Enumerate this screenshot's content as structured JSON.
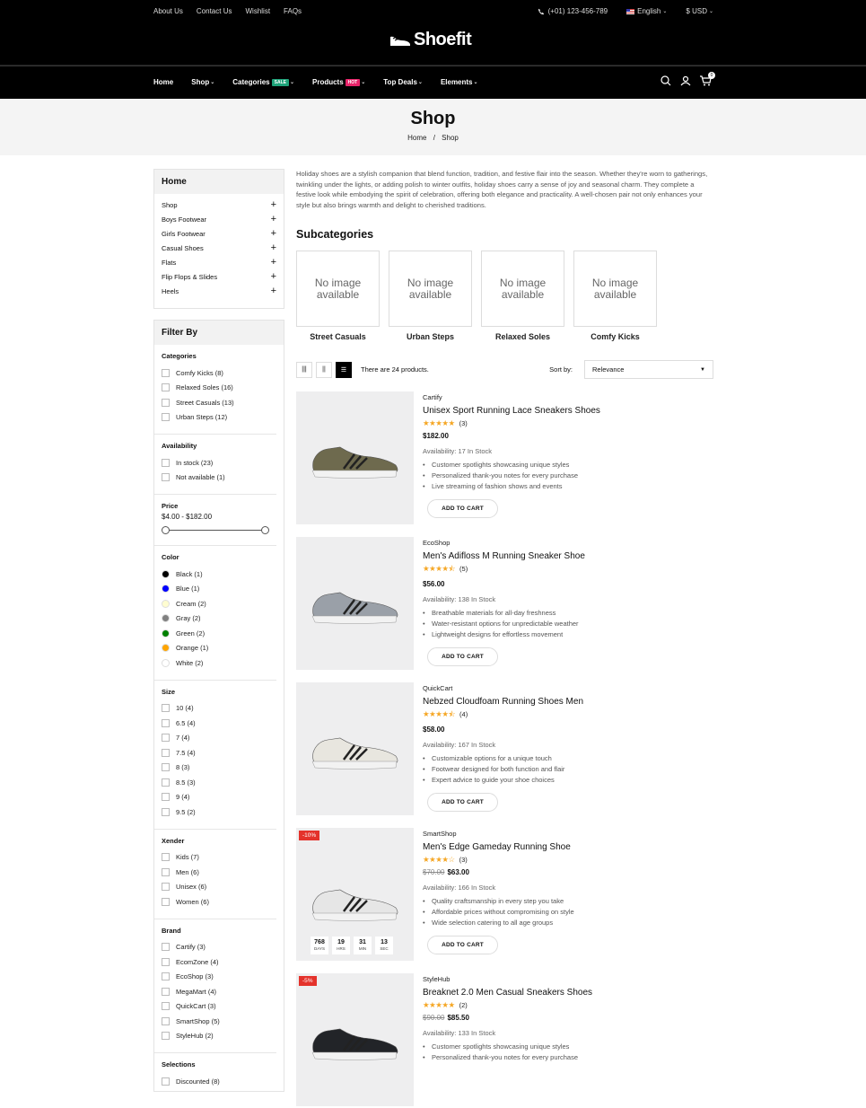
{
  "topbar": {
    "links": [
      "About Us",
      "Contact Us",
      "Wishlist",
      "FAQs"
    ],
    "phone": "(+01) 123-456-789",
    "language": "English",
    "currency": "$ USD"
  },
  "logo": {
    "text": "Shoefit"
  },
  "nav": {
    "items": [
      {
        "label": "Home"
      },
      {
        "label": "Shop"
      },
      {
        "label": "Categories",
        "badge": "SALE",
        "badge_color": "#1fa37a"
      },
      {
        "label": "Products",
        "badge": "HOT",
        "badge_color": "#e8246a"
      },
      {
        "label": "Top Deals"
      },
      {
        "label": "Elements"
      }
    ],
    "cart_count": "0"
  },
  "hero": {
    "title": "Shop",
    "crumb_home": "Home",
    "crumb_sep": "/",
    "crumb_current": "Shop"
  },
  "sidebar": {
    "cat_title": "Home",
    "categories": [
      "Shop",
      "Boys Footwear",
      "Girls Footwear",
      "Casual Shoes",
      "Flats",
      "Flip Flops & Slides",
      "Heels"
    ],
    "filter_title": "Filter By",
    "groups": [
      {
        "title": "Categories",
        "items": [
          "Comfy Kicks (8)",
          "Relaxed Soles (16)",
          "Street Casuals (13)",
          "Urban Steps (12)"
        ]
      },
      {
        "title": "Availability",
        "items": [
          "In stock (23)",
          "Not available (1)"
        ]
      },
      {
        "title": "Size",
        "items": [
          "10 (4)",
          "6.5 (4)",
          "7 (4)",
          "7.5 (4)",
          "8 (3)",
          "8.5 (3)",
          "9 (4)",
          "9.5 (2)"
        ]
      },
      {
        "title": "Xender",
        "items": [
          "Kids (7)",
          "Men (6)",
          "Unisex (6)",
          "Women (6)"
        ]
      },
      {
        "title": "Brand",
        "items": [
          "Cartify (3)",
          "EcomZone (4)",
          "EcoShop (3)",
          "MegaMart (4)",
          "QuickCart (3)",
          "SmartShop (5)",
          "StyleHub (2)"
        ]
      },
      {
        "title": "Selections",
        "items": [
          "Discounted (8)"
        ]
      }
    ],
    "price": {
      "title": "Price",
      "range": "$4.00 - $182.00"
    },
    "color": {
      "title": "Color",
      "items": [
        {
          "label": "Black (1)",
          "hex": "#000000"
        },
        {
          "label": "Blue (1)",
          "hex": "#0000ff"
        },
        {
          "label": "Cream (2)",
          "hex": "#fffdd0"
        },
        {
          "label": "Gray (2)",
          "hex": "#808080"
        },
        {
          "label": "Green (2)",
          "hex": "#008000"
        },
        {
          "label": "Orange (1)",
          "hex": "#ffa500"
        },
        {
          "label": "White (2)",
          "hex": "#ffffff"
        }
      ]
    }
  },
  "main": {
    "description": "Holiday shoes are a stylish companion that blend function, tradition, and festive flair into the season. Whether they're worn to gatherings, twinkling under the lights, or adding polish to winter outfits, holiday shoes carry a sense of joy and seasonal charm. They complete a festive look while embodying the spirit of celebration, offering both elegance and practicality. A well-chosen pair not only enhances your style but also brings warmth and delight to cherished traditions.",
    "subcat_title": "Subcategories",
    "subcats": [
      {
        "name": "Street Casuals",
        "img": "No image available"
      },
      {
        "name": "Urban Steps",
        "img": "No image available"
      },
      {
        "name": "Relaxed Soles",
        "img": "No image available"
      },
      {
        "name": "Comfy Kicks",
        "img": "No image available"
      }
    ],
    "count_text": "There are 24 products.",
    "sort_label": "Sort by:",
    "sort_value": "Relevance",
    "add_to_cart": "ADD TO CART",
    "products": [
      {
        "brand": "Cartify",
        "name": "Unisex Sport Running Lace Sneakers Shoes",
        "stars": "★★★★★",
        "rating_count": "(3)",
        "old_price": "",
        "price": "$182.00",
        "availability": "Availability: 17 In Stock",
        "features": [
          "Customer spotlights showcasing unique styles",
          "Personalized thank-you notes for every purchase",
          "Live streaming of fashion shows and events"
        ],
        "discount": "",
        "shoe": "#6e6a4e"
      },
      {
        "brand": "EcoShop",
        "name": "Men's Adifloss M Running Sneaker Shoe",
        "stars": "★★★★⯪",
        "rating_count": "(5)",
        "old_price": "",
        "price": "$56.00",
        "availability": "Availability: 138 In Stock",
        "features": [
          "Breathable materials for all-day freshness",
          "Water-resistant options for unpredictable weather",
          "Lightweight designs for effortless movement"
        ],
        "discount": "",
        "shoe": "#9aa0a8"
      },
      {
        "brand": "QuickCart",
        "name": "Nebzed Cloudfoam Running Shoes Men",
        "stars": "★★★★⯪",
        "rating_count": "(4)",
        "old_price": "",
        "price": "$58.00",
        "availability": "Availability: 167 In Stock",
        "features": [
          "Customizable options for a unique touch",
          "Footwear designed for both function and flair",
          "Expert advice to guide your shoe choices"
        ],
        "discount": "",
        "shoe": "#e8e6df"
      },
      {
        "brand": "SmartShop",
        "name": "Men's Edge Gameday Running Shoe",
        "stars": "★★★★☆",
        "rating_count": "(3)",
        "old_price": "$70.00",
        "price": "$63.00",
        "availability": "Availability: 166 In Stock",
        "features": [
          "Quality craftsmanship in every step you take",
          "Affordable prices without compromising on style",
          "Wide selection catering to all age groups"
        ],
        "discount": "-10%",
        "shoe": "#e6e6e6",
        "timer": [
          {
            "v": "768",
            "l": "DAYS"
          },
          {
            "v": "19",
            "l": "HRS"
          },
          {
            "v": "31",
            "l": "MIN"
          },
          {
            "v": "13",
            "l": "SEC"
          }
        ]
      },
      {
        "brand": "StyleHub",
        "name": "Breaknet 2.0 Men Casual Sneakers Shoes",
        "stars": "★★★★★",
        "rating_count": "(2)",
        "old_price": "$90.00",
        "price": "$85.50",
        "availability": "Availability: 133 In Stock",
        "features": [
          "Customer spotlights showcasing unique styles",
          "Personalized thank-you notes for every purchase"
        ],
        "discount": "-5%",
        "shoe": "#222428"
      }
    ]
  }
}
